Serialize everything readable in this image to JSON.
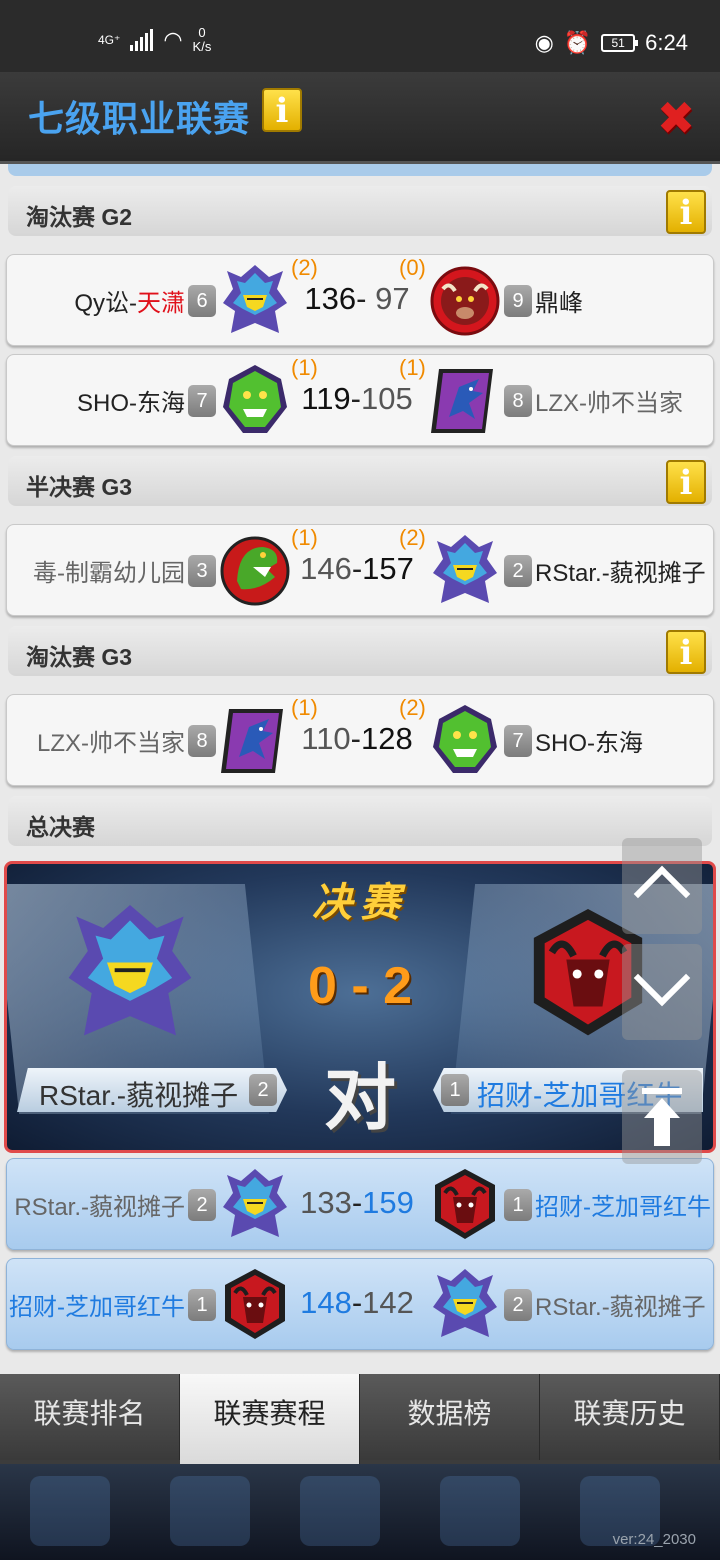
{
  "status_bar": {
    "network": "4G⁺",
    "speed_value": "0",
    "speed_unit": "K/s",
    "battery": "51",
    "time": "6:24"
  },
  "header": {
    "title": "七级职业联赛",
    "info_glyph": "i",
    "close_glyph": "✖"
  },
  "sections": [
    {
      "title": "淘汰赛 G2",
      "has_info": true
    },
    {
      "title": "半决赛 G3",
      "has_info": true
    },
    {
      "title": "淘汰赛 G3",
      "has_info": true
    },
    {
      "title": "总决赛",
      "has_info": false
    }
  ],
  "matches": [
    {
      "left_prefix": "Qy讼-",
      "left_suffix": "天潇",
      "left_seed": "6",
      "left_wins": "(2)",
      "left_score": "136",
      "dash": "-",
      "right_score": "97",
      "right_wins": "(0)",
      "right_seed": "9",
      "right_name": "鼎峰"
    },
    {
      "left_name": "SHO-东海",
      "left_seed": "7",
      "left_wins": "(1)",
      "left_score": "119",
      "dash": "-",
      "right_score": "105",
      "right_wins": "(1)",
      "right_seed": "8",
      "right_name": "LZX-帅不当家"
    },
    {
      "left_name": "毒-制霸幼儿园",
      "left_seed": "3",
      "left_wins": "(1)",
      "left_score": "146",
      "dash": "-",
      "right_score": "157",
      "right_wins": "(2)",
      "right_seed": "2",
      "right_name": "RStar.-藐视摊子"
    },
    {
      "left_name": "LZX-帅不当家",
      "left_seed": "8",
      "left_wins": "(1)",
      "left_score": "110",
      "dash": "-",
      "right_score": "128",
      "right_wins": "(2)",
      "right_seed": "7",
      "right_name": "SHO-东海"
    },
    {
      "left_name": "RStar.-藐视摊子",
      "left_seed": "2",
      "left_score": "133",
      "dash": "-",
      "right_score": "159",
      "right_seed": "1",
      "right_name": "招财-芝加哥红牛"
    },
    {
      "left_name": "招财-芝加哥红牛",
      "left_seed": "1",
      "left_score": "148",
      "dash": "-",
      "right_score": "142",
      "right_seed": "2",
      "right_name": "RStar.-藐视摊子"
    }
  ],
  "final": {
    "title": "决赛",
    "score": "0 - 2",
    "vs": "对",
    "left_name": "RStar.-藐视摊子",
    "left_seed": "2",
    "right_name": "招财-芝加哥红牛",
    "right_seed": "1"
  },
  "tabs": [
    "联赛排名",
    "联赛赛程",
    "数据榜",
    "联赛历史"
  ],
  "active_tab": "联赛赛程",
  "version": "ver:24_2030",
  "colors": {
    "title_blue": "#4aa3f0",
    "win_orange": "#f08a00",
    "final_border": "#e04a4a",
    "highlight_blue": "#1f7be0"
  }
}
